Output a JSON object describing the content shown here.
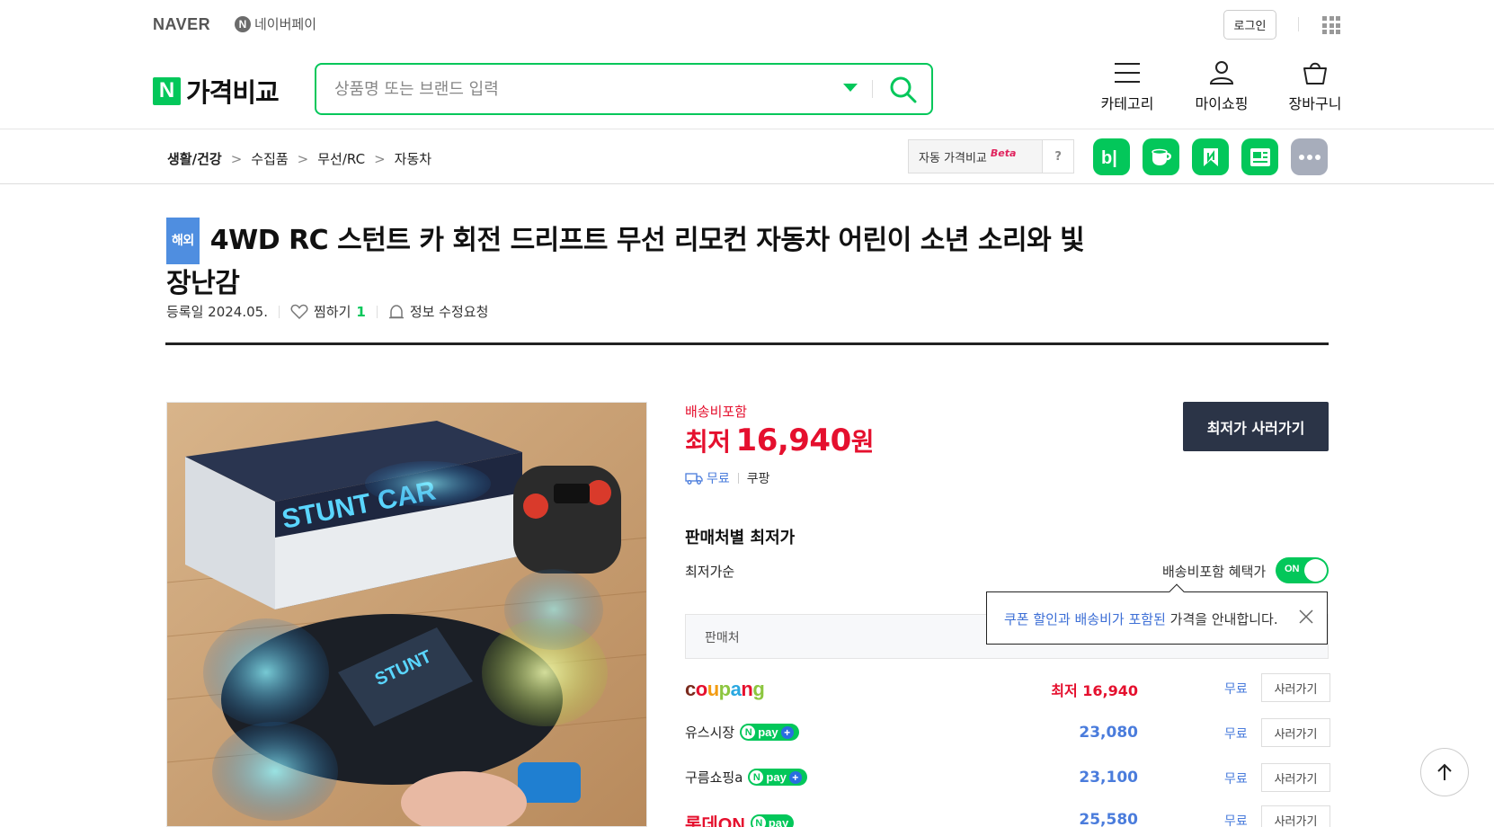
{
  "topbar": {
    "naver_logo": "NAVER",
    "npay_label": "네이버페이",
    "npay_mark": "N",
    "login_label": "로그인"
  },
  "header": {
    "brand_mark": "N",
    "brand_text": "가격비교",
    "search_placeholder": "상품명 또는 브랜드 입력",
    "menus": {
      "category": "카테고리",
      "myshopping": "마이쇼핑",
      "cart": "장바구니"
    }
  },
  "breadcrumb": {
    "items": [
      "생활/건강",
      "수집품",
      "무선/RC",
      "자동차"
    ],
    "sep": ">"
  },
  "auto_compare": {
    "label": "자동 가격비교",
    "beta": "Beta",
    "help": "?"
  },
  "product": {
    "badge": "해외",
    "title": "4WD RC 스턴트 카 회전 드리프트 무선 리모컨 자동차 어린이 소년 소리와 빛 장난감",
    "reg_date": "등록일 2024.05.",
    "zzim_label": "찜하기",
    "zzim_count": "1",
    "fix_request": "정보 수정요청"
  },
  "price": {
    "shipping_included": "배송비포함",
    "lowest_prefix": "최저",
    "lowest_value": "16,940",
    "unit": "원",
    "shipping": "무료",
    "mall": "쿠팡",
    "buy_button": "최저가 사러가기"
  },
  "sellers": {
    "section_title": "판매처별 최저가",
    "sort_label": "최저가순",
    "benefit_label": "배송비포함 혜택가",
    "toggle_label": "ON",
    "header_label": "판매처",
    "tooltip": {
      "highlight": "쿠폰 할인과 배송비가 포함된",
      "rest": " 가격을 안내합니다."
    },
    "rows": [
      {
        "mall": "coupang",
        "price": "16,940",
        "price_prefix": "최저",
        "ship": "무료",
        "btn": "사러가기"
      },
      {
        "mall": "유스시장",
        "price": "23,080",
        "ship": "무료",
        "btn": "사러가기",
        "npay": "pay"
      },
      {
        "mall": "구름쇼핑a",
        "price": "23,100",
        "ship": "무료",
        "btn": "사러가기",
        "npay": "pay"
      },
      {
        "mall": "롯데ON",
        "price": "25,580",
        "ship": "무료",
        "btn": "사러가기",
        "npay": "pay"
      }
    ]
  },
  "colors": {
    "brand_green": "#03c75a",
    "price_red": "#e5102e",
    "link_blue": "#4a7cdc",
    "dark_button": "#2b3447"
  }
}
